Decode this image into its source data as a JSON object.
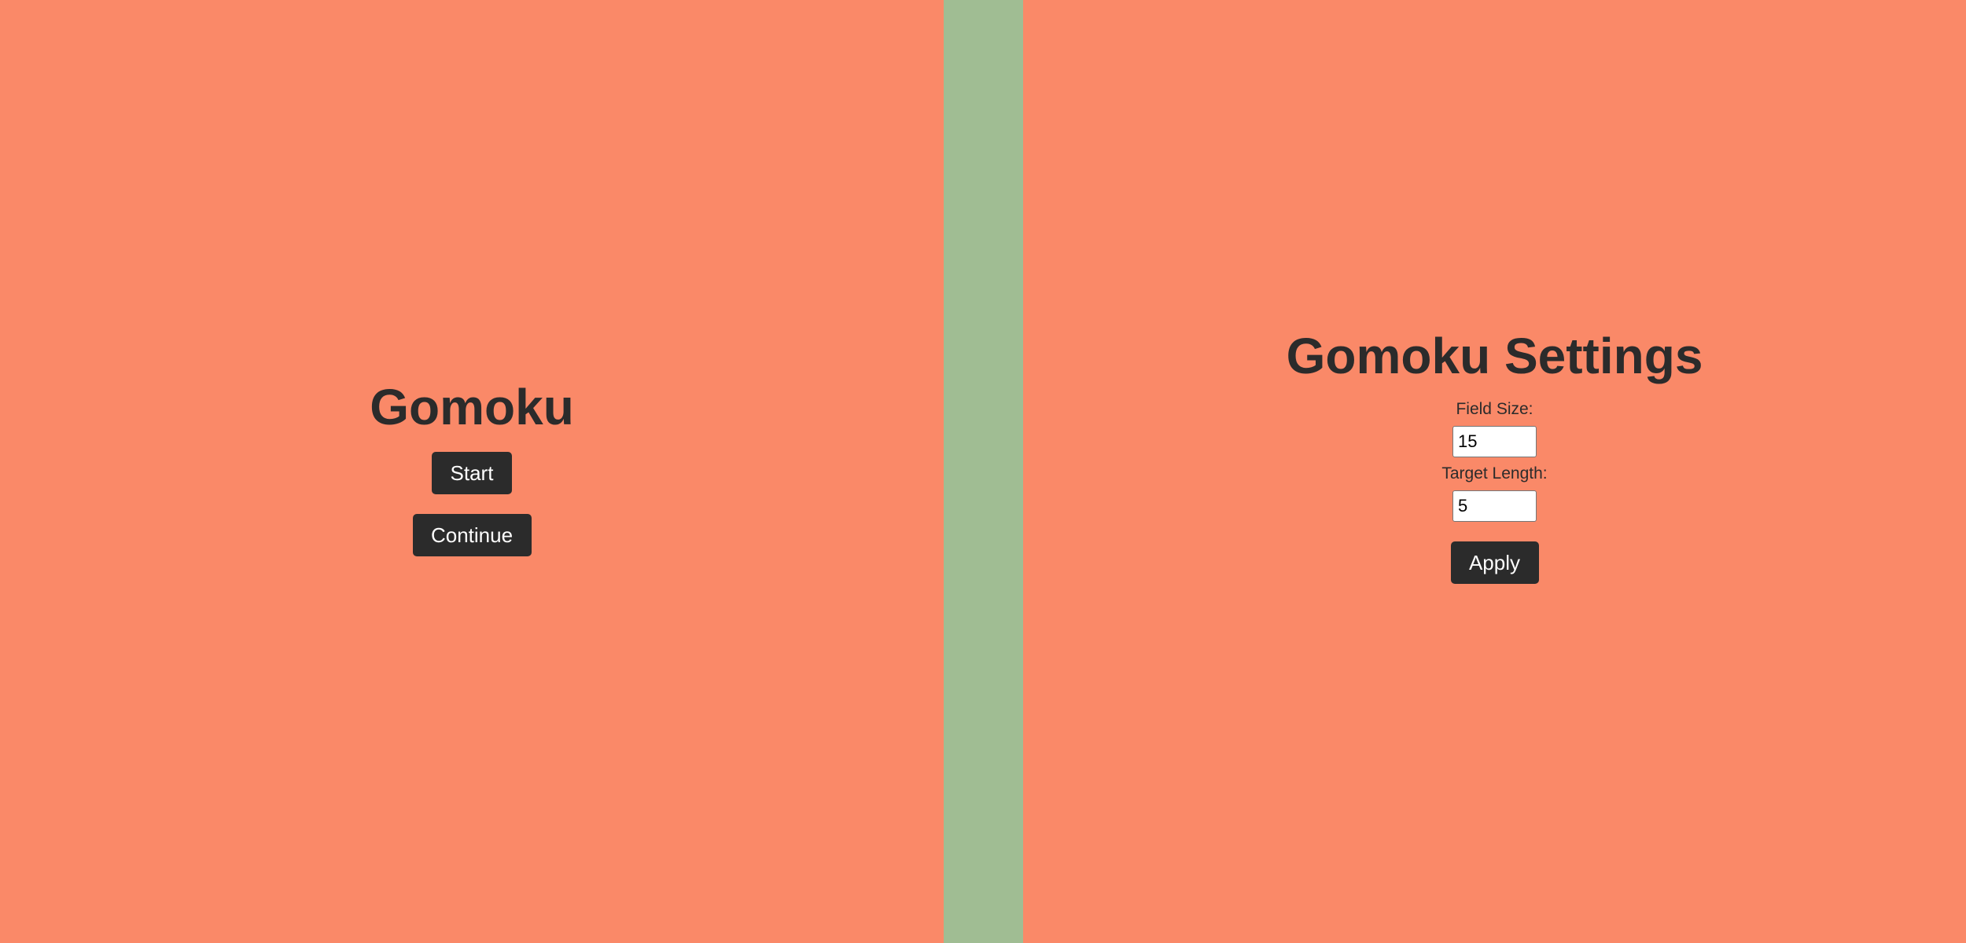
{
  "colors": {
    "background": "#fa8968",
    "divider": "#a0bd93",
    "text": "#2b2b2b",
    "button_bg": "#2b2b2b",
    "button_text": "#ffffff"
  },
  "menu": {
    "title": "Gomoku",
    "start_label": "Start",
    "continue_label": "Continue"
  },
  "settings": {
    "title": "Gomoku Settings",
    "field_size_label": "Field Size:",
    "field_size_value": "15",
    "target_length_label": "Target Length:",
    "target_length_value": "5",
    "apply_label": "Apply"
  }
}
